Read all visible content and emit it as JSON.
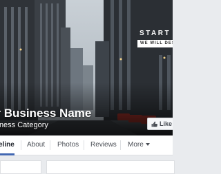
{
  "cover": {
    "image": "city-street-cover-photo",
    "promo_heading": "START YOUR",
    "promo_tag": "WE WILL DESIGN"
  },
  "page": {
    "name": "ur Business Name",
    "category": "siness Category"
  },
  "actions": {
    "like_label": "Like",
    "like_icon": "thumbs-up-icon"
  },
  "tabs": [
    {
      "label": "eline",
      "active": true
    },
    {
      "label": "About",
      "active": false
    },
    {
      "label": "Photos",
      "active": false
    },
    {
      "label": "Reviews",
      "active": false
    },
    {
      "label": "More",
      "active": false
    }
  ],
  "colors": {
    "accent": "#4267b2",
    "page_background": "#e9ebee",
    "tab_text": "#4b4f56"
  }
}
